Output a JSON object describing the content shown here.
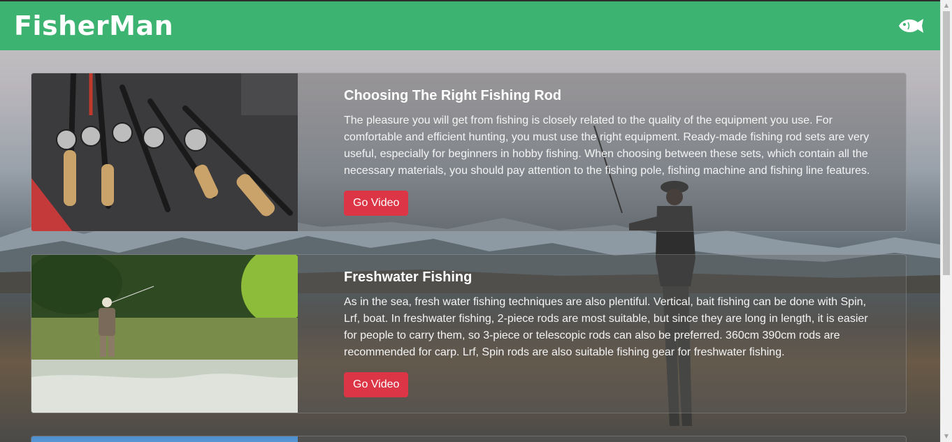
{
  "navbar": {
    "brand": "FisherMan",
    "icon": "fish-icon"
  },
  "cards": [
    {
      "title": "Choosing The Right Fishing Rod",
      "text": "The pleasure you will get from fishing is closely related to the quality of the equipment you use. For comfortable and efficient hunting, you must use the right equipment. Ready-made fishing rod sets are very useful, especially for beginners in hobby fishing. When choosing between these sets, which contain all the necessary materials, you should pay attention to the fishing pole, fishing machine and fishing line features.",
      "button": "Go Video",
      "image": "fishing-rods-image"
    },
    {
      "title": "Freshwater Fishing",
      "text": "As in the sea, fresh water fishing techniques are also plentiful. Vertical, bait fishing can be done with Spin, Lrf, boat. In freshwater fishing, 2-piece rods are most suitable, but since they are long in length, it is easier for people to carry them, so 3-piece or telescopic rods can also be preferred. 360cm 390cm rods are recommended for carp. Lrf, Spin rods are also suitable fishing gear for freshwater fishing.",
      "button": "Go Video",
      "image": "river-angler-image"
    }
  ],
  "colors": {
    "navbar": "#3cb371",
    "button": "#dc3545"
  }
}
